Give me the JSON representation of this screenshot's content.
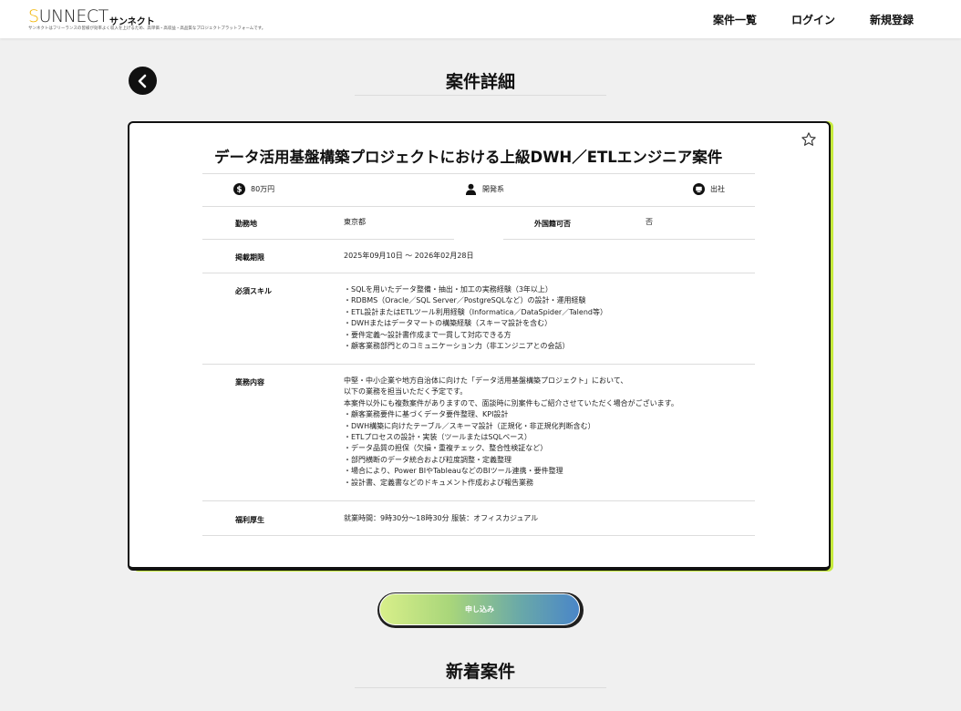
{
  "header": {
    "logo_prefix": "S",
    "logo_rest": "UNNECT",
    "logo_kana": "サンネクト",
    "tagline": "サンネクトはフリーランスの皆様が効率よく収入を上げるため、高単価・高収益・高品質なプロジェクトプラットフォームです。",
    "nav": [
      "案件一覧",
      "ログイン",
      "新規登録"
    ]
  },
  "page_title": "案件詳細",
  "job": {
    "title": "データ活用基盤構築プロジェクトにおける上級DWH／ETLエンジニア案件",
    "price": "80万円",
    "category": "開発系",
    "work_style": "出社",
    "rows": {
      "location_label": "勤務地",
      "location_value": "東京都",
      "foreign_label": "外国籍可否",
      "foreign_value": "否",
      "period_label": "掲載期限",
      "period_value": "2025年09月10日 ～ 2026年02月28日",
      "skills_label": "必須スキル",
      "skills": [
        "・SQLを用いたデータ整備・抽出・加工の実務経験（3年以上）",
        "・RDBMS（Oracle／SQL Server／PostgreSQLなど）の設計・運用経験",
        "・ETL設計またはETLツール利用経験（Informatica／DataSpider／Talend等）",
        "・DWHまたはデータマートの構築経験（スキーマ設計を含む）",
        "・要件定義～設計書作成まで一貫して対応できる方",
        "・顧客業務部門とのコミュニケーション力（非エンジニアとの会話）"
      ],
      "duties_label": "業務内容",
      "duties": [
        "中堅・中小企業や地方自治体に向けた「データ活用基盤構築プロジェクト」において、",
        "以下の業務を担当いただく予定です。",
        "本案件以外にも複数案件がありますので、面談時に別案件もご紹介させていただく場合がございます。",
        "・顧客業務要件に基づくデータ要件整理、KPI設計",
        "・DWH構築に向けたテーブル／スキーマ設計（正規化・非正規化判断含む）",
        "・ETLプロセスの設計・実装（ツールまたはSQLベース）",
        "・データ品質の担保（欠損・重複チェック、整合性検証など）",
        "・部門横断のデータ統合および粒度調整・定義整理",
        "・場合により、Power BIやTableauなどのBIツール連携・要件整理",
        "・設計書、定義書などのドキュメント作成および報告業務"
      ],
      "welfare_label": "福利厚生",
      "welfare_value": "就業時間：9時30分～18時30分 服装：オフィスカジュアル"
    }
  },
  "apply_label": "申し込み",
  "new_jobs_title": "新着案件",
  "colors": {
    "accent_yellow": "#f1b400",
    "card_accent": "#c6ea3c",
    "button_gradient_start": "#d8ef8a",
    "button_gradient_end": "#4a86c8"
  }
}
